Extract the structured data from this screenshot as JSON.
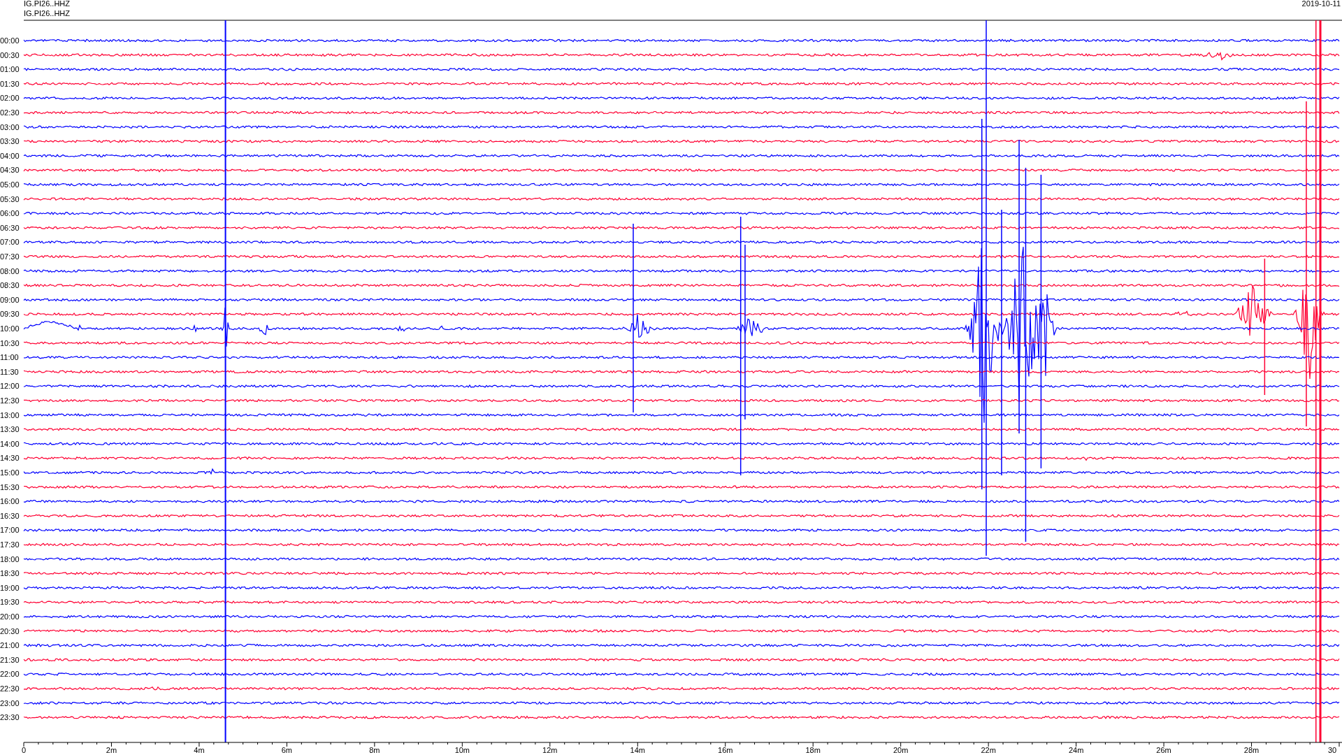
{
  "plot": {
    "station_labels": [
      "IG.PI26..HHZ",
      "IG.PI26..HHZ"
    ],
    "date": "2019-10-11",
    "rows": [
      {
        "time": "00:00",
        "color": "#0000ff"
      },
      {
        "time": "00:30",
        "color": "#ff0033"
      },
      {
        "time": "01:00",
        "color": "#0000ff"
      },
      {
        "time": "01:30",
        "color": "#ff0033"
      },
      {
        "time": "02:00",
        "color": "#0000ff"
      },
      {
        "time": "02:30",
        "color": "#ff0033"
      },
      {
        "time": "03:00",
        "color": "#0000ff"
      },
      {
        "time": "03:30",
        "color": "#ff0033"
      },
      {
        "time": "04:00",
        "color": "#0000ff"
      },
      {
        "time": "04:30",
        "color": "#ff0033"
      },
      {
        "time": "05:00",
        "color": "#0000ff"
      },
      {
        "time": "05:30",
        "color": "#ff0033"
      },
      {
        "time": "06:00",
        "color": "#0000ff"
      },
      {
        "time": "06:30",
        "color": "#ff0033"
      },
      {
        "time": "07:00",
        "color": "#0000ff"
      },
      {
        "time": "07:30",
        "color": "#ff0033"
      },
      {
        "time": "08:00",
        "color": "#0000ff"
      },
      {
        "time": "08:30",
        "color": "#ff0033"
      },
      {
        "time": "09:00",
        "color": "#0000ff"
      },
      {
        "time": "09:30",
        "color": "#ff0033"
      },
      {
        "time": "10:00",
        "color": "#0000ff"
      },
      {
        "time": "10:30",
        "color": "#ff0033"
      },
      {
        "time": "11:00",
        "color": "#0000ff"
      },
      {
        "time": "11:30",
        "color": "#ff0033"
      },
      {
        "time": "12:00",
        "color": "#0000ff"
      },
      {
        "time": "12:30",
        "color": "#ff0033"
      },
      {
        "time": "13:00",
        "color": "#0000ff"
      },
      {
        "time": "13:30",
        "color": "#ff0033"
      },
      {
        "time": "14:00",
        "color": "#0000ff"
      },
      {
        "time": "14:30",
        "color": "#ff0033"
      },
      {
        "time": "15:00",
        "color": "#0000ff"
      },
      {
        "time": "15:30",
        "color": "#ff0033"
      },
      {
        "time": "16:00",
        "color": "#0000ff"
      },
      {
        "time": "16:30",
        "color": "#ff0033"
      },
      {
        "time": "17:00",
        "color": "#0000ff"
      },
      {
        "time": "17:30",
        "color": "#ff0033"
      },
      {
        "time": "18:00",
        "color": "#0000ff"
      },
      {
        "time": "18:30",
        "color": "#ff0033"
      },
      {
        "time": "19:00",
        "color": "#0000ff"
      },
      {
        "time": "19:30",
        "color": "#ff0033"
      },
      {
        "time": "20:00",
        "color": "#0000ff"
      },
      {
        "time": "20:30",
        "color": "#ff0033"
      },
      {
        "time": "21:00",
        "color": "#0000ff"
      },
      {
        "time": "21:30",
        "color": "#ff0033"
      },
      {
        "time": "22:00",
        "color": "#0000ff"
      },
      {
        "time": "22:30",
        "color": "#ff0033"
      },
      {
        "time": "23:00",
        "color": "#0000ff"
      },
      {
        "time": "23:30",
        "color": "#ff0033"
      }
    ],
    "x_axis": {
      "ticks": [
        "0",
        "2m",
        "4m",
        "6m",
        "8m",
        "10m",
        "12m",
        "14m",
        "16m",
        "18m",
        "20m",
        "22m",
        "24m",
        "26m",
        "28m",
        "30"
      ]
    }
  }
}
